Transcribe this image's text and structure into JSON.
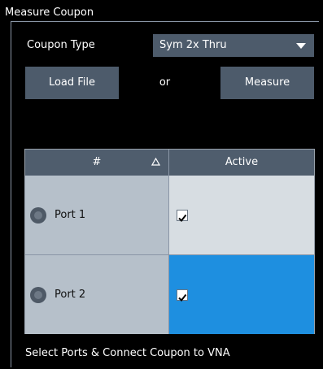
{
  "group": {
    "title": "Measure Coupon"
  },
  "coupon_type": {
    "label": "Coupon Type",
    "selected": "Sym 2x Thru"
  },
  "actions": {
    "load_file": "Load File",
    "or": "or",
    "measure": "Measure"
  },
  "table": {
    "columns": [
      "#",
      "Active"
    ],
    "sort": "ascending",
    "rows": [
      {
        "port": "Port 1",
        "active": true,
        "selected": false
      },
      {
        "port": "Port 2",
        "active": true,
        "selected": true
      }
    ]
  },
  "status": "Select Ports & Connect Coupon to VNA",
  "colors": {
    "background": "#000000",
    "button": "#4d5b6b",
    "header": "#4f5d6d",
    "row_inactive": "#b6c0ca",
    "cell_light": "#d7dde2",
    "selection": "#1e8fe0"
  }
}
